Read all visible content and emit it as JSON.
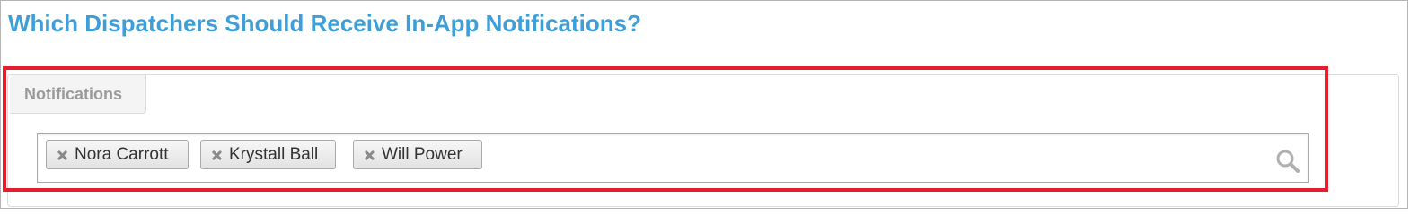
{
  "page": {
    "title": "Which Dispatchers Should Receive In-App Notifications?"
  },
  "section": {
    "tab_label": "Notifications"
  },
  "selector": {
    "selected": [
      {
        "label": "Nora Carrott"
      },
      {
        "label": "Krystall Ball"
      },
      {
        "label": "Will Power"
      }
    ],
    "search_icon": "search-icon",
    "remove_icon": "close-icon"
  },
  "colors": {
    "title": "#3e9fd8",
    "highlight": "#e0202e",
    "tab_text": "#9a9a9a"
  }
}
